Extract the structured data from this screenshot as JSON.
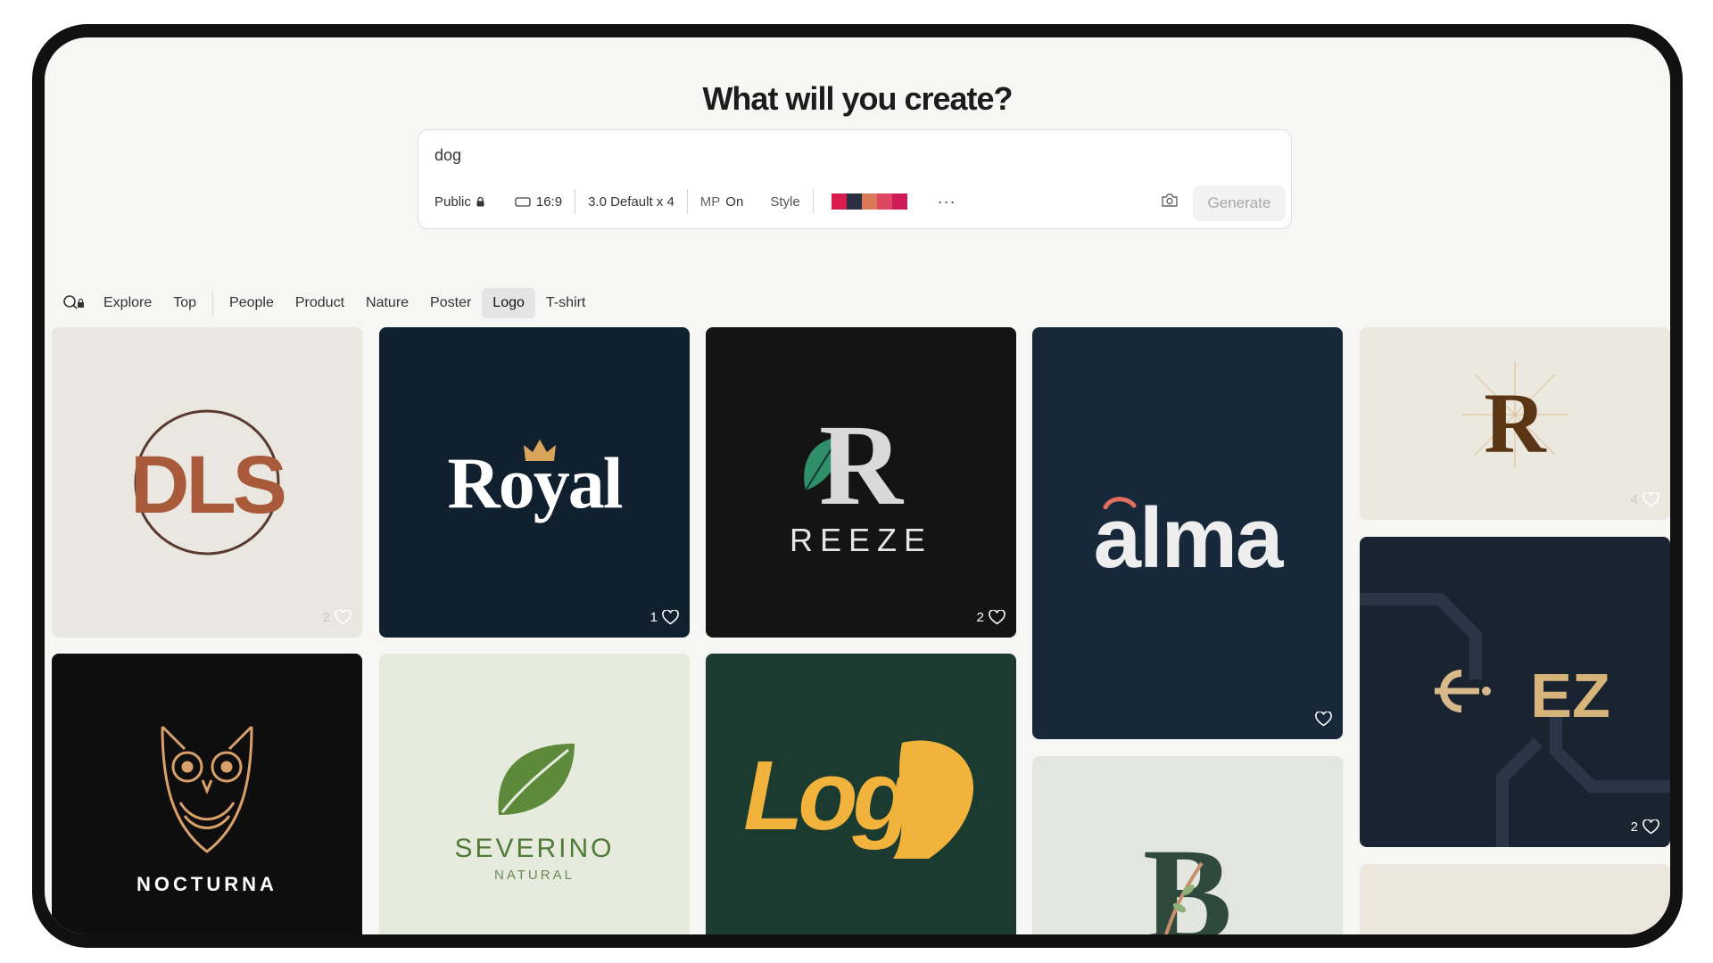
{
  "header": {
    "title": "What will you create?"
  },
  "prompt": {
    "value": "dog",
    "visibility": "Public",
    "aspect": "16:9",
    "model": "3.0 Default x 4",
    "mp_label": "MP",
    "mp_value": "On",
    "style_label": "Style",
    "palette": [
      "#d81c4e",
      "#2b2f44",
      "#d9795a",
      "#de4761",
      "#cf1a5a"
    ],
    "more_label": "···",
    "generate_label": "Generate"
  },
  "filters": {
    "items": [
      "Explore",
      "Top",
      "People",
      "Product",
      "Nature",
      "Poster",
      "Logo",
      "T-shirt"
    ],
    "active": "Logo"
  },
  "gallery": {
    "cards": [
      {
        "id": "dls",
        "text": "DLS",
        "likes": "2"
      },
      {
        "id": "royal",
        "text": "Royal",
        "likes": "1"
      },
      {
        "id": "reeze",
        "text": "REEZE",
        "likes": "2"
      },
      {
        "id": "alma",
        "text": "alma",
        "likes": ""
      },
      {
        "id": "lion-r",
        "text": "R",
        "likes": "4"
      },
      {
        "id": "ez",
        "text": "EZ",
        "likes": "2"
      },
      {
        "id": "nocturna",
        "text": "NOCTURNA",
        "likes": ""
      },
      {
        "id": "severino",
        "text": "SEVERINO",
        "subtext": "NATURAL",
        "likes": ""
      },
      {
        "id": "logo-lion",
        "text": "Log",
        "likes": ""
      },
      {
        "id": "b-leaf",
        "text": "B",
        "likes": ""
      }
    ]
  },
  "colors": {
    "screen_bg": "#f6f6f5",
    "royal_bg": "#11202f",
    "reeze_bg": "#141414",
    "alma_bg": "#16283a",
    "logo_lion_bg": "#1c3b30",
    "gold": "#f2b33d",
    "leaf_green": "#5c8a3a"
  }
}
